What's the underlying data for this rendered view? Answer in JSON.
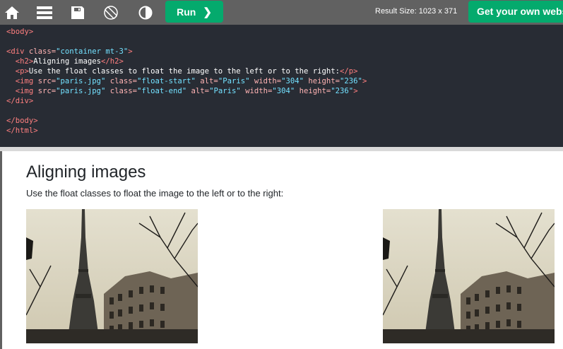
{
  "toolbar": {
    "icons": [
      "home-icon",
      "menu-icon",
      "save-icon",
      "rotate-icon",
      "contrast-icon"
    ],
    "run_label": "Run",
    "result_size": "Result Size: 1023 x 371",
    "get_website_label": "Get your own website"
  },
  "editor": {
    "lines": [
      [
        {
          "t": "tag",
          "v": "<body>"
        }
      ],
      [],
      [
        {
          "t": "tag",
          "v": "<div "
        },
        {
          "t": "attr",
          "v": "class="
        },
        {
          "t": "val",
          "v": "\"container mt-3\""
        },
        {
          "t": "tag",
          "v": ">"
        }
      ],
      [
        {
          "t": "text",
          "v": "  "
        },
        {
          "t": "tag",
          "v": "<h2>"
        },
        {
          "t": "text",
          "v": "Aligning images"
        },
        {
          "t": "tag",
          "v": "</h2>"
        }
      ],
      [
        {
          "t": "text",
          "v": "  "
        },
        {
          "t": "tag",
          "v": "<p>"
        },
        {
          "t": "text",
          "v": "Use the float classes to float the image to the left or to the right:"
        },
        {
          "t": "tag",
          "v": "</p>"
        }
      ],
      [
        {
          "t": "text",
          "v": "  "
        },
        {
          "t": "tag",
          "v": "<img "
        },
        {
          "t": "attr",
          "v": "src="
        },
        {
          "t": "val",
          "v": "\"paris.jpg\""
        },
        {
          "t": "attr",
          "v": " class="
        },
        {
          "t": "val",
          "v": "\"float-start\""
        },
        {
          "t": "attr",
          "v": " alt="
        },
        {
          "t": "val",
          "v": "\"Paris\""
        },
        {
          "t": "attr",
          "v": " width="
        },
        {
          "t": "val",
          "v": "\"304\""
        },
        {
          "t": "attr",
          "v": " height="
        },
        {
          "t": "val",
          "v": "\"236\""
        },
        {
          "t": "tag",
          "v": ">"
        }
      ],
      [
        {
          "t": "text",
          "v": "  "
        },
        {
          "t": "tag",
          "v": "<img "
        },
        {
          "t": "attr",
          "v": "src="
        },
        {
          "t": "val",
          "v": "\"paris.jpg\""
        },
        {
          "t": "attr",
          "v": " class="
        },
        {
          "t": "val",
          "v": "\"float-end\""
        },
        {
          "t": "attr",
          "v": " alt="
        },
        {
          "t": "val",
          "v": "\"Paris\""
        },
        {
          "t": "attr",
          "v": " width="
        },
        {
          "t": "val",
          "v": "\"304\""
        },
        {
          "t": "attr",
          "v": " height="
        },
        {
          "t": "val",
          "v": "\"236\""
        },
        {
          "t": "tag",
          "v": ">"
        }
      ],
      [
        {
          "t": "tag",
          "v": "</div>"
        }
      ],
      [],
      [
        {
          "t": "tag",
          "v": "</body>"
        }
      ],
      [
        {
          "t": "tag",
          "v": "</html>"
        }
      ]
    ]
  },
  "result": {
    "title": "Aligning images",
    "paragraph": "Use the float classes to float the image to the left or to the right:",
    "images": [
      {
        "alt": "Paris",
        "float": "left"
      },
      {
        "alt": "Paris",
        "float": "right"
      }
    ]
  },
  "colors": {
    "toolbar_bg": "#616161",
    "accent_green": "#04aa6d",
    "editor_bg": "#282c34",
    "tag": "#ff7f7f",
    "attr": "#ffb3b3",
    "value": "#73e1ff"
  }
}
